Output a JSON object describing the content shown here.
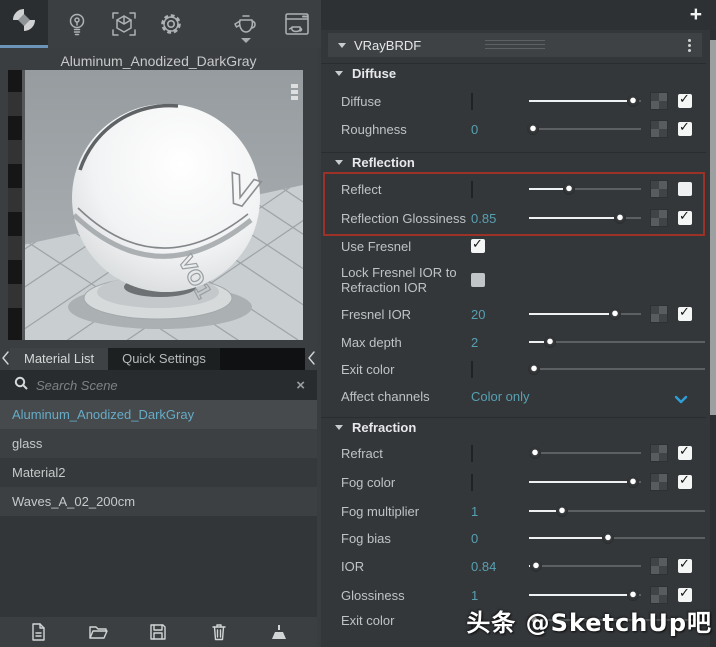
{
  "toolbar": {
    "add_label": "+",
    "icons": [
      "vray-logo-icon",
      "materials-icon",
      "geometry-icon",
      "settings-gear-icon",
      "render-teapot-icon",
      "render-window-icon"
    ]
  },
  "left": {
    "preview_title": "Aluminum_Anodized_DarkGray",
    "tabs": [
      {
        "label": "Material List"
      },
      {
        "label": "Quick Settings"
      }
    ],
    "search_placeholder": "Search Scene",
    "clear_label": "×",
    "materials": [
      {
        "name": "Aluminum_Anodized_DarkGray",
        "selected": true
      },
      {
        "name": "glass",
        "selected": false
      },
      {
        "name": "Material2",
        "selected": false
      },
      {
        "name": "Waves_A_02_200cm",
        "selected": false
      }
    ],
    "bottom_icons": [
      "new-material-icon",
      "open-folder-icon",
      "save-icon",
      "delete-trash-icon",
      "purge-brush-icon"
    ]
  },
  "panel": {
    "title": "VRayBRDF",
    "sections": {
      "diffuse": "Diffuse",
      "reflection": "Reflection",
      "refraction": "Refraction"
    },
    "rows": {
      "diffuse": {
        "label": "Diffuse"
      },
      "roughness": {
        "label": "Roughness",
        "value": "0"
      },
      "reflect": {
        "label": "Reflect"
      },
      "reflection_glossiness": {
        "label": "Reflection Glossiness",
        "value": "0.85"
      },
      "use_fresnel": {
        "label": "Use Fresnel"
      },
      "lock_fresnel": {
        "line1": "Lock Fresnel IOR to",
        "line2": "Refraction IOR"
      },
      "fresnel_ior": {
        "label": "Fresnel IOR",
        "value": "20"
      },
      "max_depth": {
        "label": "Max depth",
        "value": "2"
      },
      "exit_color": {
        "label": "Exit color"
      },
      "affect_channels": {
        "label": "Affect channels",
        "value": "Color only"
      },
      "refract": {
        "label": "Refract"
      },
      "fog_color": {
        "label": "Fog color"
      },
      "fog_multiplier": {
        "label": "Fog multiplier",
        "value": "1"
      },
      "fog_bias": {
        "label": "Fog bias",
        "value": "0"
      },
      "ior": {
        "label": "IOR",
        "value": "0.84"
      },
      "glossiness": {
        "label": "Glossiness",
        "value": "1"
      },
      "exit_color_refraction": {
        "label": "Exit color"
      }
    }
  },
  "colors": {
    "value_teal": "#57a0b2",
    "selected_material_blue": "#66abc7",
    "highlight_red": "#9c3127",
    "reflect_swatch_tan": "#b3a892",
    "active_tab_underline_blue": "#6b94b8",
    "dropdown_chevron_blue": "#2f9fd8",
    "diffuse_swatch": "#ffffff",
    "exit_color_swatch": "#050505",
    "fog_color_swatch": "#ffffff",
    "refract_swatch": "#050505"
  },
  "watermark": "头条 @SketchUp吧"
}
